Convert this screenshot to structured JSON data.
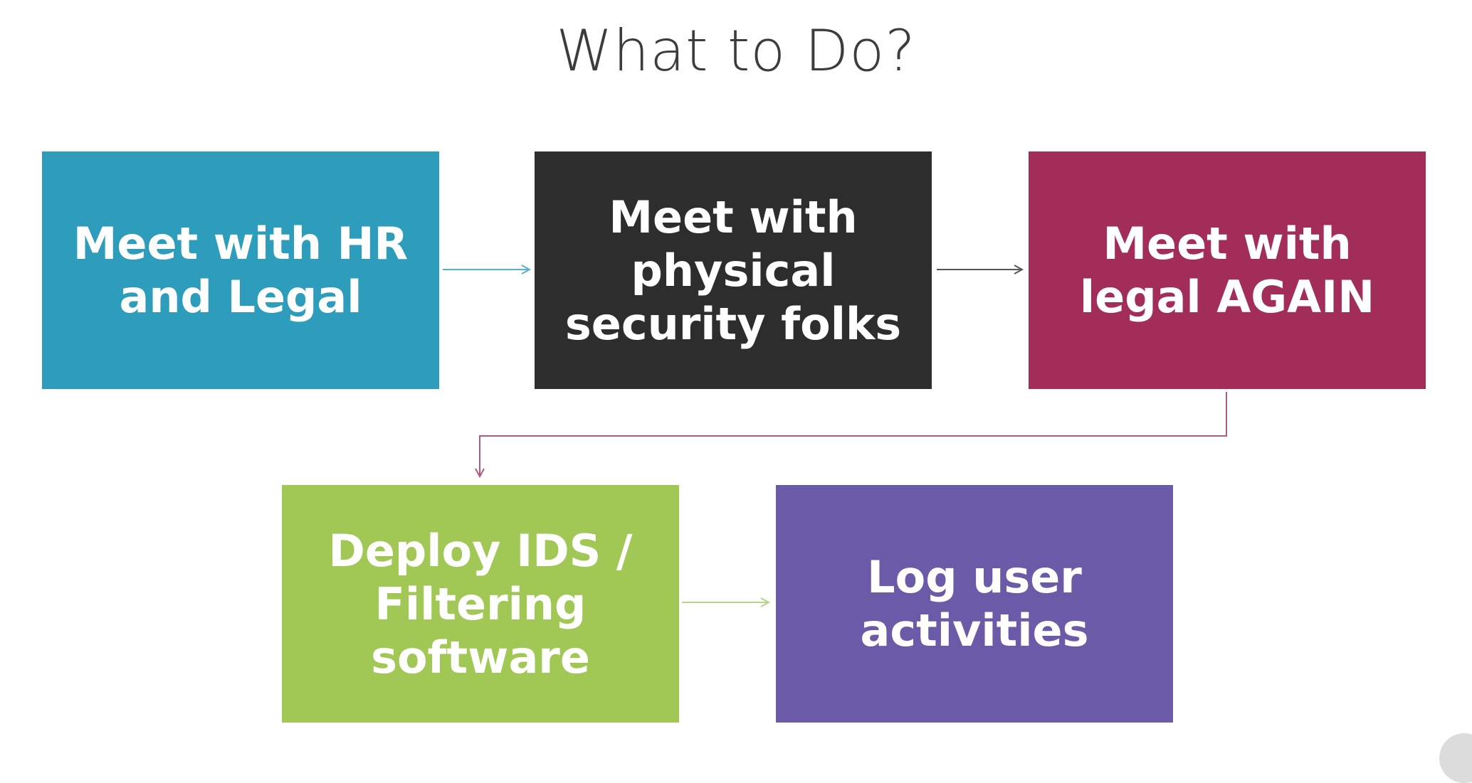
{
  "title": "What to Do?",
  "steps": [
    {
      "id": "hr-legal",
      "label": "Meet with HR\nand Legal",
      "color": "#2e9dbc"
    },
    {
      "id": "physical-security",
      "label": "Meet with\nphysical\nsecurity folks",
      "color": "#2d2d2d"
    },
    {
      "id": "legal-again",
      "label": "Meet with\nlegal AGAIN",
      "color": "#a32d59"
    },
    {
      "id": "deploy-ids",
      "label": "Deploy IDS /\nFiltering\nsoftware",
      "color": "#a1c755"
    },
    {
      "id": "log-activities",
      "label": "Log user\nactivities",
      "color": "#6b5aa8"
    }
  ],
  "connector_colors": {
    "step1_to_step2": "#5aaed0",
    "step2_to_step3": "#555555",
    "step3_to_step4": "#b05a80",
    "step4_to_step5": "#b5d58a"
  }
}
